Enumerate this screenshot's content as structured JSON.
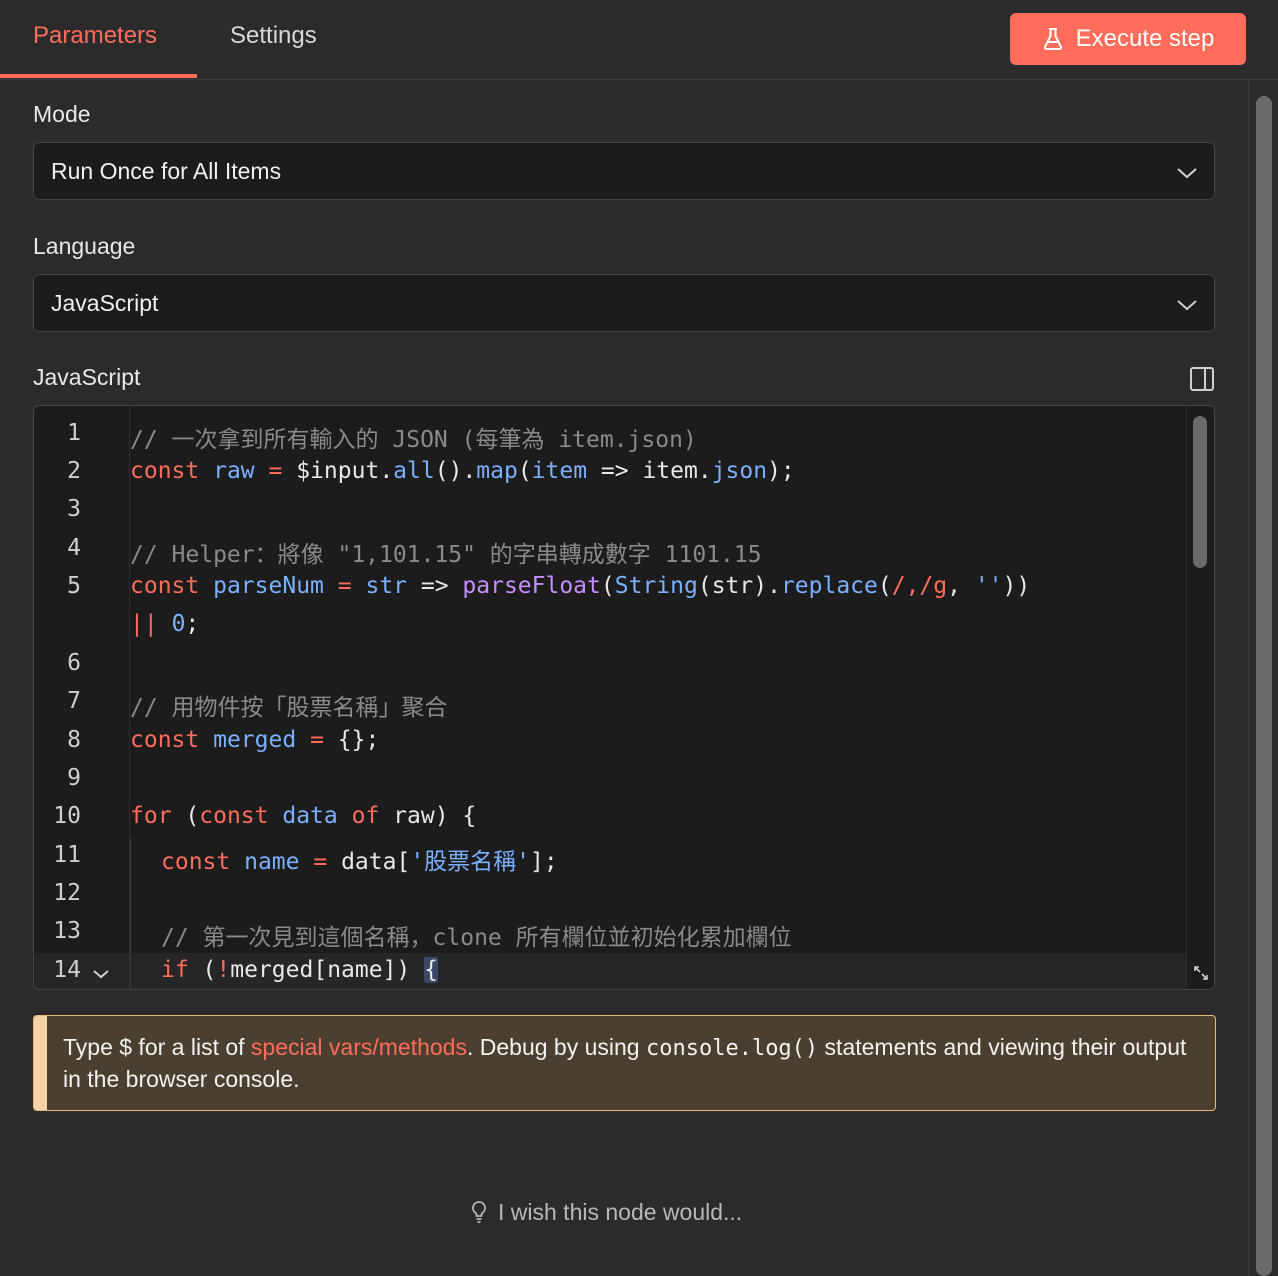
{
  "tabs": [
    {
      "label": "Parameters",
      "active": true
    },
    {
      "label": "Settings",
      "active": false
    }
  ],
  "execute_button": {
    "label": "Execute step",
    "icon": "flask-icon",
    "color": "#ff6d5a"
  },
  "fields": {
    "mode": {
      "label": "Mode",
      "value": "Run Once for All Items"
    },
    "language": {
      "label": "Language",
      "value": "JavaScript"
    },
    "code_label": "JavaScript"
  },
  "code": {
    "line_numbers": [
      "1",
      "2",
      "3",
      "4",
      "5",
      "",
      "6",
      "7",
      "8",
      "9",
      "10",
      "11",
      "12",
      "13",
      "14"
    ],
    "lines": {
      "l1": "// 一次拿到所有輸入的 JSON (每筆為 item.json)",
      "l2": {
        "a": "const",
        "b": "raw",
        "c": "=",
        "d": "$input.",
        "e": "all",
        "f": "().",
        "g": "map",
        "h": "(",
        "i": "item",
        "j": " => item.",
        "k": "json",
        "l": ");"
      },
      "l4": "// Helper：將像 \"1,101.15\" 的字串轉成數字 1101.15",
      "l5": {
        "a": "const",
        "b": "parseNum",
        "c": "=",
        "d": "str",
        "e": " => ",
        "f": "parseFloat",
        "g": "(",
        "h": "String",
        "i": "(str).",
        "j": "replace",
        "k": "(",
        "l": "/,/g",
        "m": ", ",
        "n": "''",
        "o": "))"
      },
      "l5b": {
        "a": "||",
        "b": "0",
        "c": ";"
      },
      "l7": "// 用物件按「股票名稱」聚合",
      "l8": {
        "a": "const",
        "b": "merged",
        "c": "=",
        "d": " {};"
      },
      "l10": {
        "a": "for",
        "b": " (",
        "c": "const",
        "d": "data",
        "e": "of",
        "f": " raw) {"
      },
      "l11": {
        "a": "const",
        "b": "name",
        "c": "=",
        "d": " data[",
        "e": "'股票名稱'",
        "f": "];"
      },
      "l13": "// 第一次見到這個名稱，clone 所有欄位並初始化累加欄位",
      "l14": {
        "a": "if",
        "b": " (",
        "c": "!",
        "d": "merged[name]) ",
        "e": "{"
      }
    }
  },
  "notice": {
    "prefix": "Type $ for a list of ",
    "link": "special vars/methods",
    "middle": ". Debug by using ",
    "code": "console.log()",
    "suffix": " statements and viewing their output in the browser console."
  },
  "wish": {
    "label": "I wish this node would...",
    "icon": "lightbulb-icon"
  },
  "colors": {
    "accent": "#ff6d5a",
    "background": "#2b2b2c",
    "editor_bg": "#1c1c1d",
    "notice_bg": "#4b3f30"
  }
}
